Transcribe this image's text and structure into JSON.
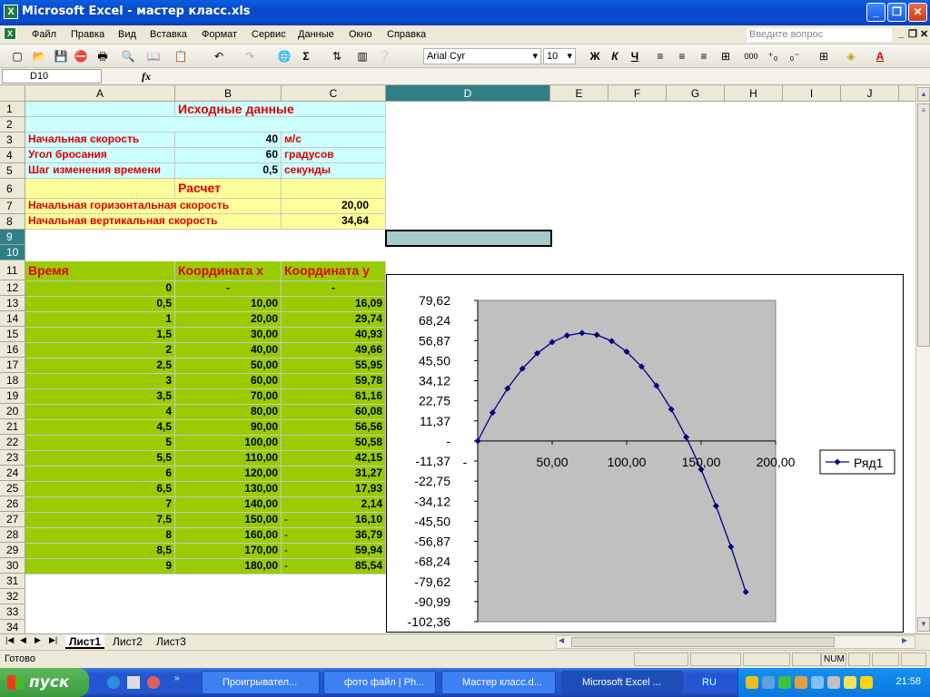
{
  "window": {
    "title": "Microsoft Excel - мастер класс.xls"
  },
  "menu": {
    "items": [
      "Файл",
      "Правка",
      "Вид",
      "Вставка",
      "Формат",
      "Сервис",
      "Данные",
      "Окно",
      "Справка"
    ],
    "ask_placeholder": "Введите вопрос"
  },
  "toolbar": {
    "font_name": "Arial Cyr",
    "font_size": "10",
    "bold": "Ж",
    "italic": "К",
    "underline": "Ч",
    "sum": "Σ",
    "thousands": "000"
  },
  "formula": {
    "name_box": "D10",
    "fx": "fx",
    "content": ""
  },
  "columns": [
    "A",
    "B",
    "C",
    "D",
    "E",
    "F",
    "G",
    "H",
    "I",
    "J"
  ],
  "rows": [
    "1",
    "2",
    "3",
    "4",
    "5",
    "6",
    "7",
    "8",
    "9",
    "10",
    "11",
    "12",
    "13",
    "14",
    "15",
    "16",
    "17",
    "18",
    "19",
    "20",
    "21",
    "22",
    "23",
    "24",
    "25",
    "26",
    "27",
    "28",
    "29",
    "30",
    "31",
    "32",
    "33",
    "34"
  ],
  "sheet": {
    "header": "Исходные данные",
    "inputs": [
      {
        "label": "Начальная скорость",
        "value": "40",
        "unit": "м/с"
      },
      {
        "label": "Угол бросания",
        "value": "60",
        "unit": "градусов"
      },
      {
        "label": "Шаг изменения времени",
        "value": "0,5",
        "unit": "секунды"
      }
    ],
    "calc_header": "Расчет",
    "calcs": [
      {
        "label": "Начальная горизонтальная скорость",
        "value": "20,00"
      },
      {
        "label": "Начальная вертикальная скорость",
        "value": "34,64"
      }
    ],
    "table_headers": [
      "Время",
      "Координата x",
      "Координата y"
    ],
    "table": [
      [
        "0",
        "-",
        "-"
      ],
      [
        "0,5",
        "10,00",
        "16,09"
      ],
      [
        "1",
        "20,00",
        "29,74"
      ],
      [
        "1,5",
        "30,00",
        "40,93"
      ],
      [
        "2",
        "40,00",
        "49,66"
      ],
      [
        "2,5",
        "50,00",
        "55,95"
      ],
      [
        "3",
        "60,00",
        "59,78"
      ],
      [
        "3,5",
        "70,00",
        "61,16"
      ],
      [
        "4",
        "80,00",
        "60,08"
      ],
      [
        "4,5",
        "90,00",
        "56,56"
      ],
      [
        "5",
        "100,00",
        "50,58"
      ],
      [
        "5,5",
        "110,00",
        "42,15"
      ],
      [
        "6",
        "120,00",
        "31,27"
      ],
      [
        "6,5",
        "130,00",
        "17,93"
      ],
      [
        "7",
        "140,00",
        "2,14"
      ],
      [
        "7,5",
        "150,00",
        "-",
        "16,10"
      ],
      [
        "8",
        "160,00",
        "-",
        "36,79"
      ],
      [
        "8,5",
        "170,00",
        "-",
        "59,94"
      ],
      [
        "9",
        "180,00",
        "-",
        "85,54"
      ]
    ]
  },
  "chart_data": {
    "type": "line",
    "title": "",
    "xlabel": "",
    "ylabel": "",
    "x": [
      0,
      10,
      20,
      30,
      40,
      50,
      60,
      70,
      80,
      90,
      100,
      110,
      120,
      130,
      140,
      150,
      160,
      170,
      180
    ],
    "series": [
      {
        "name": "Ряд1",
        "values": [
          0,
          16.09,
          29.74,
          40.93,
          49.66,
          55.95,
          59.78,
          61.16,
          60.08,
          56.56,
          50.58,
          42.15,
          31.27,
          17.93,
          2.14,
          -16.1,
          -36.79,
          -59.94,
          -85.54
        ]
      }
    ],
    "xlim": [
      0,
      200
    ],
    "ylim": [
      -102.36,
      79.62
    ],
    "x_tick_labels": [
      "-",
      "50,00",
      "100,00",
      "150,00",
      "200,00"
    ],
    "x_tick_values": [
      0,
      50,
      100,
      150,
      200
    ],
    "y_tick_labels": [
      "79,62",
      "68,24",
      "56,87",
      "45,50",
      "34,12",
      "22,75",
      "11,37",
      "-",
      "-11,37",
      "-22,75",
      "-34,12",
      "-45,50",
      "-56,87",
      "-68,24",
      "-79,62",
      "-90,99",
      "-102,36"
    ],
    "y_tick_values": [
      79.62,
      68.24,
      56.87,
      45.5,
      34.12,
      22.75,
      11.37,
      0,
      -11.37,
      -22.75,
      -34.12,
      -45.5,
      -56.87,
      -68.24,
      -79.62,
      -90.99,
      -102.36
    ],
    "legend_position": "right",
    "plot_bg": "#c0c0c0",
    "series_color": "#000080"
  },
  "sheet_tabs": [
    "Лист1",
    "Лист2",
    "Лист3"
  ],
  "status": {
    "ready": "Готово",
    "num": "NUM"
  },
  "taskbar": {
    "start": "пуск",
    "tasks": [
      "Проигрывател...",
      "фото файл | Ph...",
      "Мастер класс.d...",
      "Microsoft Excel ..."
    ],
    "lang": "RU",
    "clock": "21:58"
  },
  "colors": {
    "title_bar": "#0a5ee0",
    "cyan_fill": "#ccffff",
    "yellow_fill": "#ffff99",
    "green_fill": "#99cc00",
    "red_text": "#e00000",
    "selection": "#2f7f86"
  }
}
